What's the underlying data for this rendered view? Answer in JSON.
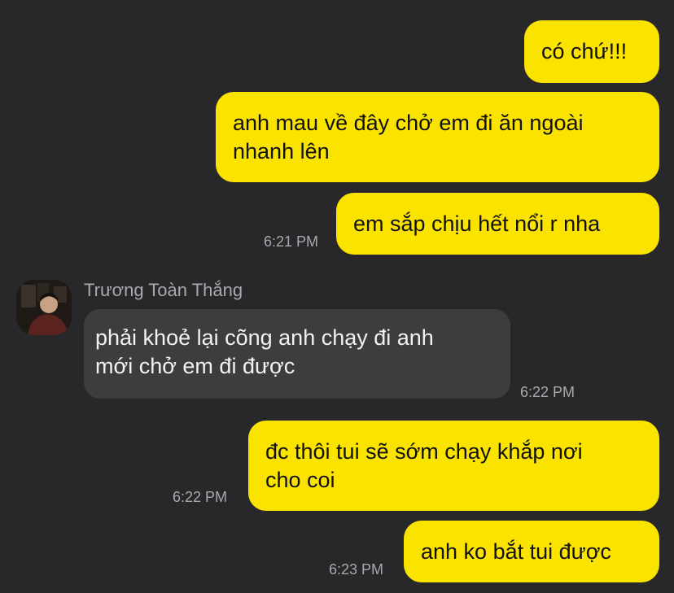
{
  "chat": {
    "contact": {
      "name": "Trương Toàn Thắng"
    },
    "messages": [
      {
        "direction": "outgoing",
        "lines": [
          "có chứ!!!"
        ],
        "time": ""
      },
      {
        "direction": "outgoing",
        "lines": [
          "anh mau về đây chở em đi ăn ngoài",
          "nhanh lên"
        ],
        "time": ""
      },
      {
        "direction": "outgoing",
        "lines": [
          "em sắp chịu hết nổi r nha"
        ],
        "time": "6:21 PM"
      },
      {
        "direction": "incoming",
        "lines": [
          "phải khoẻ lại cõng anh chạy đi anh",
          "mới chở em đi được"
        ],
        "time": "6:22 PM"
      },
      {
        "direction": "outgoing",
        "lines": [
          "đc thôi tui sẽ sớm chạy khắp nơi",
          "cho coi"
        ],
        "time": "6:22 PM"
      },
      {
        "direction": "outgoing",
        "lines": [
          "anh ko bắt tui được"
        ],
        "time": "6:23 PM"
      }
    ]
  },
  "colors": {
    "background": "#28282a",
    "outgoing_bubble": "#fbe300",
    "incoming_bubble": "#3d3d40",
    "timestamp_text": "#a9a9ad"
  }
}
